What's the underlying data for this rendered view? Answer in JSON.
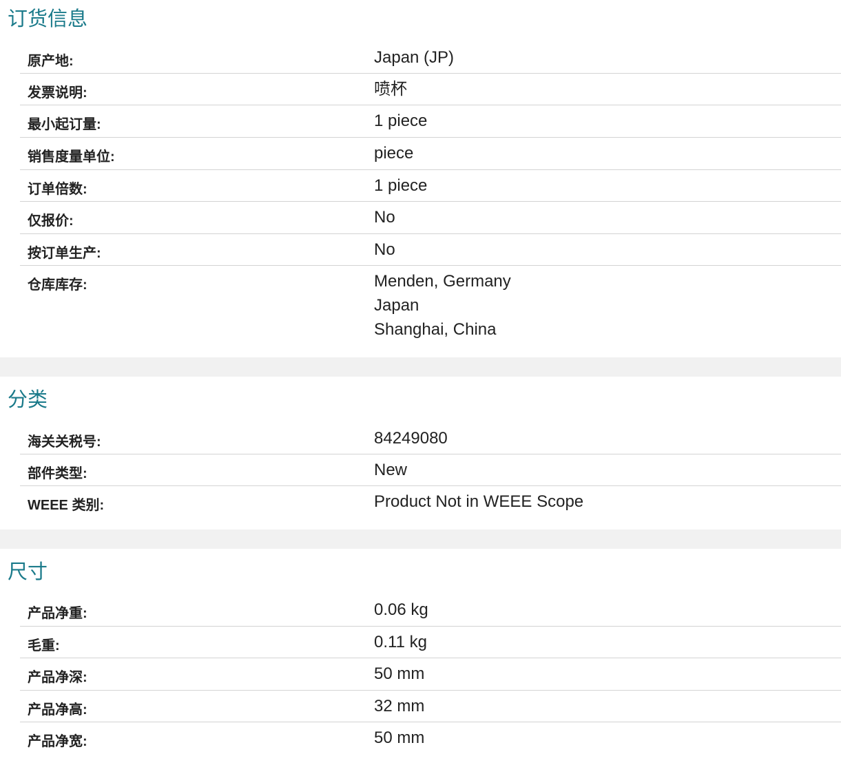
{
  "sections": [
    {
      "title": "订货信息",
      "rows": [
        {
          "label": "原产地:",
          "value": [
            "Japan (JP)"
          ]
        },
        {
          "label": "发票说明:",
          "value": [
            "喷杯"
          ]
        },
        {
          "label": "最小起订量:",
          "value": [
            "1 piece"
          ]
        },
        {
          "label": "销售度量单位:",
          "value": [
            "piece"
          ]
        },
        {
          "label": "订单倍数:",
          "value": [
            "1 piece"
          ]
        },
        {
          "label": "仅报价:",
          "value": [
            "No"
          ]
        },
        {
          "label": "按订单生产:",
          "value": [
            "No"
          ]
        },
        {
          "label": "仓库库存:",
          "value": [
            "Menden, Germany",
            "Japan",
            "Shanghai, China"
          ]
        }
      ]
    },
    {
      "title": "分类",
      "rows": [
        {
          "label": "海关关税号:",
          "value": [
            "84249080"
          ]
        },
        {
          "label": "部件类型:",
          "value": [
            "New"
          ]
        },
        {
          "label": "WEEE 类别:",
          "value": [
            "Product Not in WEEE Scope"
          ]
        }
      ]
    },
    {
      "title": "尺寸",
      "rows": [
        {
          "label": "产品净重:",
          "value": [
            "0.06 kg"
          ]
        },
        {
          "label": "毛重:",
          "value": [
            "0.11 kg"
          ]
        },
        {
          "label": "产品净深:",
          "value": [
            "50 mm"
          ]
        },
        {
          "label": "产品净高:",
          "value": [
            "32 mm"
          ]
        },
        {
          "label": "产品净宽:",
          "value": [
            "50 mm"
          ]
        }
      ]
    }
  ]
}
